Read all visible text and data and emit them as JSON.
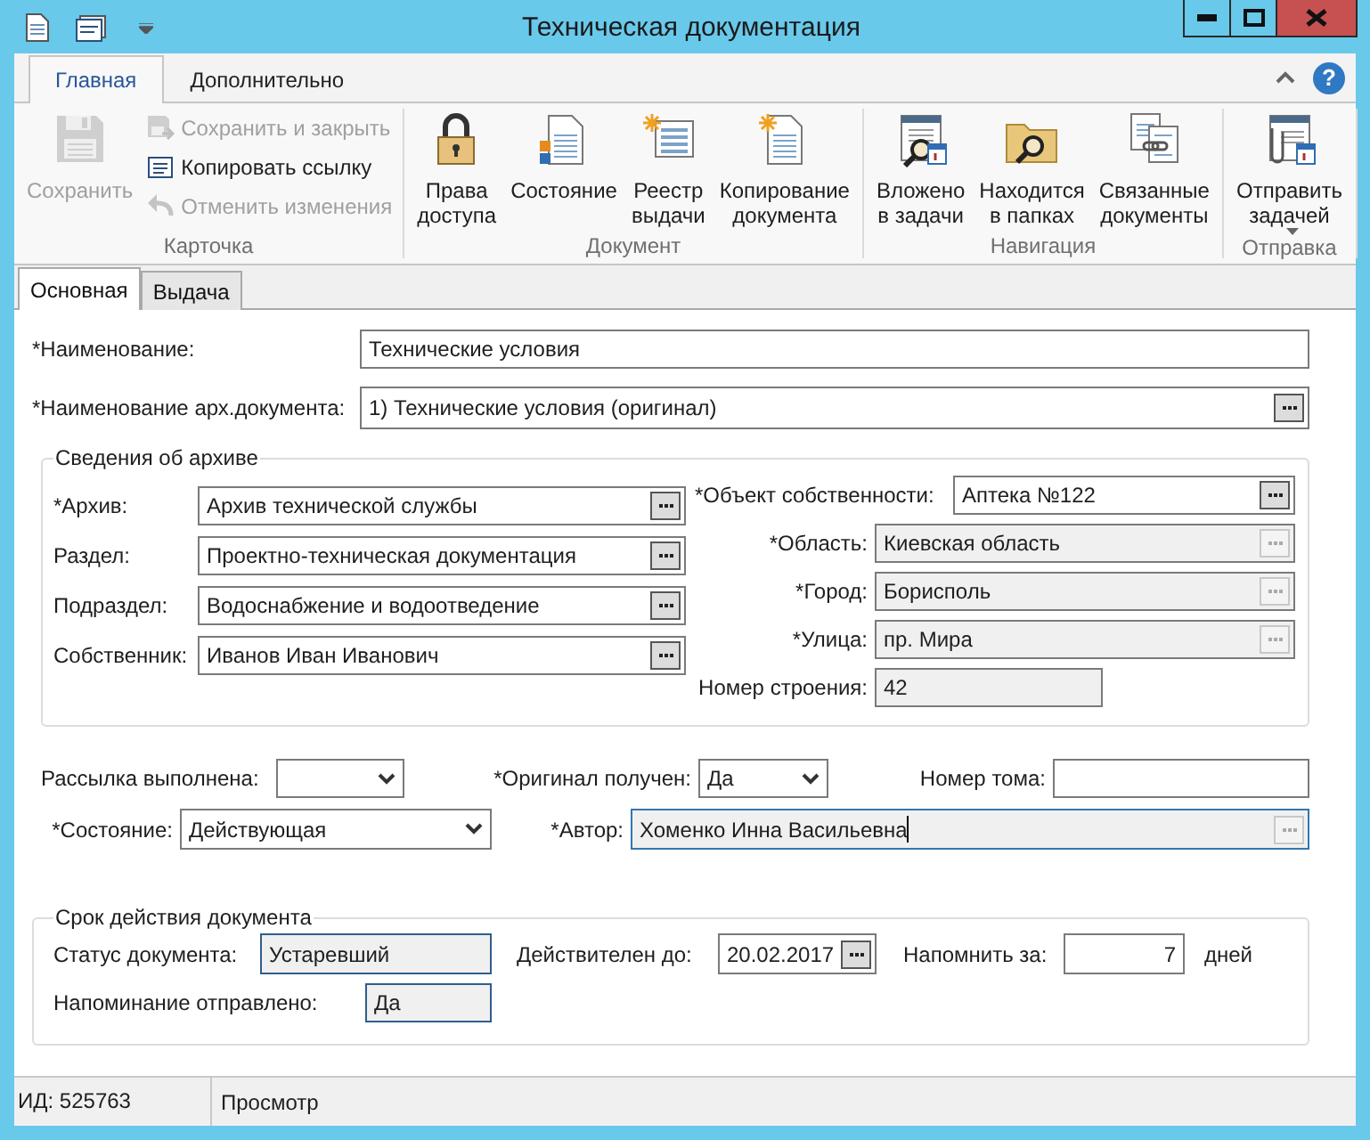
{
  "window": {
    "title": "Техническая документация"
  },
  "ribbon": {
    "tabs": [
      {
        "label": "Главная",
        "selected": true
      },
      {
        "label": "Дополнительно",
        "selected": false
      }
    ],
    "help": "?",
    "groups": [
      {
        "label": "Карточка",
        "buttons": [
          {
            "kind": "large",
            "label": "Сохранить",
            "disabled": true,
            "dropdown": false
          },
          {
            "kind": "small",
            "label": "Сохранить и закрыть",
            "disabled": true,
            "dropdown": false
          },
          {
            "kind": "small",
            "label": "Копировать ссылку",
            "disabled": false,
            "dropdown": false
          },
          {
            "kind": "small",
            "label": "Отменить изменения",
            "disabled": true,
            "dropdown": false
          }
        ]
      },
      {
        "label": "Документ",
        "buttons": [
          {
            "kind": "large",
            "label": "Права\nдоступа",
            "disabled": false,
            "dropdown": false
          },
          {
            "kind": "large",
            "label": "Состояние",
            "disabled": false,
            "dropdown": false
          },
          {
            "kind": "large",
            "label": "Реестр\nвыдачи",
            "disabled": false,
            "dropdown": false
          },
          {
            "kind": "large",
            "label": "Копирование\nдокумента",
            "disabled": false,
            "dropdown": false
          }
        ]
      },
      {
        "label": "Навигация",
        "buttons": [
          {
            "kind": "large",
            "label": "Вложено\nв задачи",
            "disabled": false,
            "dropdown": false
          },
          {
            "kind": "large",
            "label": "Находится\nв папках",
            "disabled": false,
            "dropdown": false
          },
          {
            "kind": "large",
            "label": "Связанные\nдокументы",
            "disabled": false,
            "dropdown": false
          }
        ]
      },
      {
        "label": "Отправка",
        "buttons": [
          {
            "kind": "large",
            "label": "Отправить\nзадачей",
            "disabled": false,
            "dropdown": true
          }
        ]
      }
    ]
  },
  "doc_tabs": [
    {
      "label": "Основная",
      "selected": true
    },
    {
      "label": "Выдача",
      "selected": false
    }
  ],
  "form": {
    "name_rows": [
      {
        "label": "*Наименование:",
        "kind": "text",
        "value": "Технические условия",
        "readonly": false,
        "focused": false
      },
      {
        "label": "*Наименование арх.документа:",
        "kind": "lookup",
        "value": "1) Технические условия (оригинал)",
        "readonly": false,
        "focused": false
      }
    ],
    "archive": {
      "title": "Сведения об архиве",
      "left": [
        {
          "label": "*Архив:",
          "kind": "lookup",
          "value": "Архив технической службы",
          "readonly": false,
          "focused": false
        },
        {
          "label": "Раздел:",
          "kind": "lookup",
          "value": "Проектно-техническая документация",
          "readonly": false,
          "focused": false
        },
        {
          "label": "Подраздел:",
          "kind": "lookup",
          "value": "Водоснабжение и водоотведение",
          "readonly": false,
          "focused": false
        },
        {
          "label": "Собственник:",
          "kind": "lookup",
          "value": "Иванов Иван Иванович",
          "readonly": false,
          "focused": false
        }
      ],
      "right": [
        {
          "label": "*Объект собственности:",
          "kind": "lookup",
          "value": "Аптека №122",
          "readonly": false,
          "focused": false
        },
        {
          "label": "*Область:",
          "kind": "lookup",
          "value": "Киевская область",
          "readonly": true,
          "focused": false
        },
        {
          "label": "*Город:",
          "kind": "lookup",
          "value": "Борисполь",
          "readonly": true,
          "focused": false
        },
        {
          "label": "*Улица:",
          "kind": "lookup",
          "value": "пр. Мира",
          "readonly": true,
          "focused": false
        },
        {
          "label": "Номер строения:",
          "kind": "text",
          "value": "42",
          "readonly": true,
          "focused": false
        }
      ]
    },
    "extra_rows": [
      [
        {
          "label": "Рассылка выполнена:",
          "kind": "combo",
          "readonly": false,
          "focused": false
        },
        {
          "label": "*Оригинал получен:",
          "kind": "combo",
          "value": "Да",
          "readonly": false,
          "focused": false
        },
        {
          "label": "Номер тома:",
          "kind": "text",
          "readonly": false,
          "focused": false
        }
      ],
      [
        {
          "label": "*Состояние:",
          "kind": "combo",
          "value": "Действующая",
          "readonly": false,
          "focused": false
        },
        {
          "label": "*Автор:",
          "kind": "lookup",
          "value": "Хоменко Инна Васильевна",
          "readonly": true,
          "focused": true
        }
      ]
    ],
    "validity": {
      "title": "Срок действия документа",
      "rows": [
        [
          {
            "label": "Статус документа:",
            "kind": "text",
            "value": "Устаревший",
            "readonly": true,
            "focused": false
          },
          {
            "label": "Действителен до:",
            "kind": "lookup",
            "value": "20.02.2017",
            "readonly": false,
            "focused": false
          },
          {
            "label": "Напомнить за:",
            "kind": "number",
            "value": "7",
            "suffix": "дней",
            "readonly": false,
            "focused": false
          }
        ],
        [
          {
            "label": "Напоминание отправлено:",
            "kind": "text",
            "value": "Да",
            "readonly": true,
            "focused": false
          }
        ]
      ]
    }
  },
  "status_bar": [
    "ИД: 525763",
    "Просмотр"
  ]
}
